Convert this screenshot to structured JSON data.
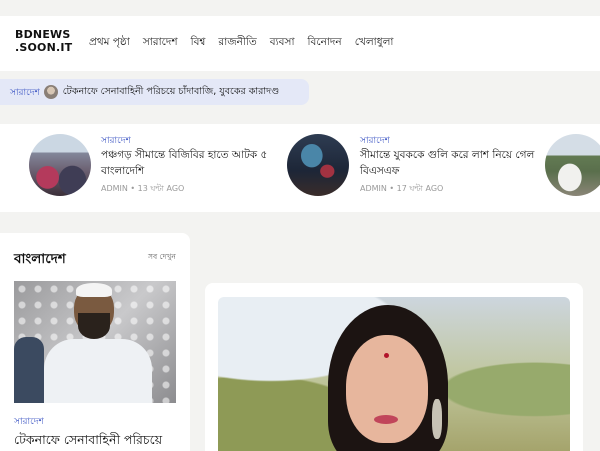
{
  "site": {
    "logo_line1": "BDNEWS",
    "logo_line2": ".SOON.IT"
  },
  "nav": {
    "items": [
      {
        "label": "প্রথম পৃষ্ঠা"
      },
      {
        "label": "সারাদেশ"
      },
      {
        "label": "বিশ্ব"
      },
      {
        "label": "রাজনীতি"
      },
      {
        "label": "ব্যবসা"
      },
      {
        "label": "বিনোদন"
      },
      {
        "label": "খেলাধুলা"
      }
    ]
  },
  "ticker": {
    "category": "সারাদেশ",
    "headline": "টেকনাফে সেনাবাহিনী পরিচয়ে চাঁদাবাজি, যুবকের কারাদণ্ড"
  },
  "top_stories": [
    {
      "category": "সারাদেশ",
      "title": "পঞ্চগড় সীমান্তে বিজিবির হাতে আটক ৫ বাংলাদেশি",
      "meta": "ADMIN • 13 ঘন্টা AGO"
    },
    {
      "category": "সারাদেশ",
      "title": "সীমান্তে যুবককে গুলি করে লাশ নিয়ে গেল বিএসএফ",
      "meta": "ADMIN • 17 ঘন্টা AGO"
    }
  ],
  "section": {
    "title": "বাংলাদেশ",
    "see_all": "সব দেখুন",
    "lead": {
      "category": "সারাদেশ",
      "headline": "টেকনাফে সেনাবাহিনী পরিচয়ে"
    }
  },
  "colors": {
    "accent": "#3d56c4",
    "ticker_bg": "#e4e8f7",
    "page_bg": "#f3f3f1"
  }
}
